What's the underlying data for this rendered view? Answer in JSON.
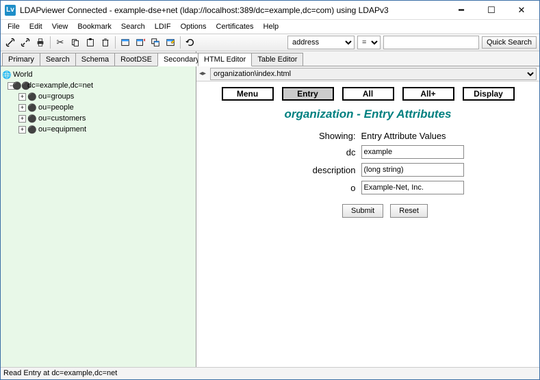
{
  "window": {
    "app_abbrev": "Lv",
    "title": "LDAPviewer Connected - example-dse+net (ldap://localhost:389/dc=example,dc=com) using LDAPv3"
  },
  "menubar": [
    "File",
    "Edit",
    "View",
    "Bookmark",
    "Search",
    "LDIF",
    "Options",
    "Certificates",
    "Help"
  ],
  "search": {
    "attr_selected": "address",
    "op_selected": "=",
    "value": "",
    "button": "Quick Search"
  },
  "left_tabs": [
    "Primary",
    "Search",
    "Schema",
    "RootDSE",
    "Secondary"
  ],
  "left_active_tab": 4,
  "tree": {
    "root": "World",
    "base": "dc=example,dc=net",
    "children": [
      "ou=groups",
      "ou=people",
      "ou=customers",
      "ou=equipment"
    ]
  },
  "right_tabs": [
    "HTML Editor",
    "Table Editor"
  ],
  "right_active_tab": 0,
  "path": "organization\\index.html",
  "nav_buttons": [
    "Menu",
    "Entry",
    "All",
    "All+",
    "Display"
  ],
  "nav_active": 1,
  "section_title": "organization - Entry Attributes",
  "form": {
    "showing_label": "Showing:",
    "showing_value": "Entry Attribute Values",
    "rows": [
      {
        "label": "dc",
        "value": "example"
      },
      {
        "label": "description",
        "value": "(long string)"
      },
      {
        "label": "o",
        "value": "Example-Net, Inc."
      }
    ],
    "submit": "Submit",
    "reset": "Reset"
  },
  "status": "Read Entry at dc=example,dc=net"
}
